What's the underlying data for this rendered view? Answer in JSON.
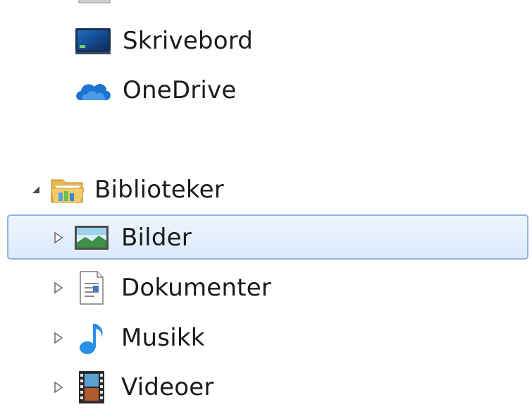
{
  "nav_tree": {
    "favorites": [
      {
        "label": "Skrivebord",
        "icon": "desktop-icon"
      },
      {
        "label": "OneDrive",
        "icon": "onedrive-cloud-icon"
      }
    ],
    "libraries": {
      "label": "Biblioteker",
      "icon": "libraries-folder-icon",
      "expanded": true,
      "children": [
        {
          "label": "Bilder",
          "icon": "pictures-icon",
          "selected": true
        },
        {
          "label": "Dokumenter",
          "icon": "documents-icon",
          "selected": false
        },
        {
          "label": "Musikk",
          "icon": "music-note-icon",
          "selected": false
        },
        {
          "label": "Videoer",
          "icon": "videos-filmstrip-icon",
          "selected": false
        }
      ]
    }
  },
  "colors": {
    "selection_border": "#8fb4e3",
    "selection_fill": "#dceafb",
    "onedrive_blue": "#1e73d2",
    "music_blue": "#2a8ee6"
  }
}
